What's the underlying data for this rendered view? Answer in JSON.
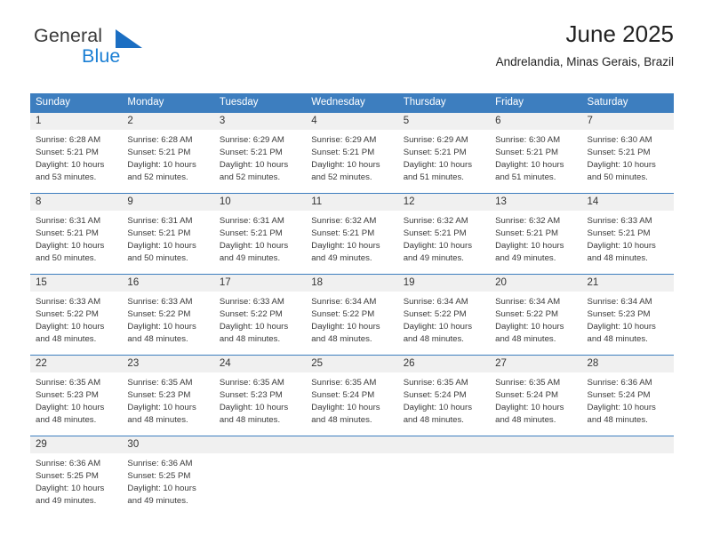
{
  "brand": {
    "name_part1": "General",
    "name_part2": "Blue",
    "mark_icon": "triangle-flag-icon",
    "colors": {
      "text": "#3a3a3a",
      "accent": "#1b7fd4"
    }
  },
  "header": {
    "title": "June 2025",
    "subtitle": "Andrelandia, Minas Gerais, Brazil"
  },
  "theme": {
    "header_bg": "#3d7ebf",
    "header_text": "#ffffff",
    "daynum_bg": "#f0f0f0",
    "grid_line": "#3d7ebf",
    "body_text": "#3a3a3a"
  },
  "calendar": {
    "weekday_headers": [
      "Sunday",
      "Monday",
      "Tuesday",
      "Wednesday",
      "Thursday",
      "Friday",
      "Saturday"
    ],
    "weeks": [
      [
        {
          "day": "1",
          "sunrise": "Sunrise: 6:28 AM",
          "sunset": "Sunset: 5:21 PM",
          "daylight": "Daylight: 10 hours and 53 minutes."
        },
        {
          "day": "2",
          "sunrise": "Sunrise: 6:28 AM",
          "sunset": "Sunset: 5:21 PM",
          "daylight": "Daylight: 10 hours and 52 minutes."
        },
        {
          "day": "3",
          "sunrise": "Sunrise: 6:29 AM",
          "sunset": "Sunset: 5:21 PM",
          "daylight": "Daylight: 10 hours and 52 minutes."
        },
        {
          "day": "4",
          "sunrise": "Sunrise: 6:29 AM",
          "sunset": "Sunset: 5:21 PM",
          "daylight": "Daylight: 10 hours and 52 minutes."
        },
        {
          "day": "5",
          "sunrise": "Sunrise: 6:29 AM",
          "sunset": "Sunset: 5:21 PM",
          "daylight": "Daylight: 10 hours and 51 minutes."
        },
        {
          "day": "6",
          "sunrise": "Sunrise: 6:30 AM",
          "sunset": "Sunset: 5:21 PM",
          "daylight": "Daylight: 10 hours and 51 minutes."
        },
        {
          "day": "7",
          "sunrise": "Sunrise: 6:30 AM",
          "sunset": "Sunset: 5:21 PM",
          "daylight": "Daylight: 10 hours and 50 minutes."
        }
      ],
      [
        {
          "day": "8",
          "sunrise": "Sunrise: 6:31 AM",
          "sunset": "Sunset: 5:21 PM",
          "daylight": "Daylight: 10 hours and 50 minutes."
        },
        {
          "day": "9",
          "sunrise": "Sunrise: 6:31 AM",
          "sunset": "Sunset: 5:21 PM",
          "daylight": "Daylight: 10 hours and 50 minutes."
        },
        {
          "day": "10",
          "sunrise": "Sunrise: 6:31 AM",
          "sunset": "Sunset: 5:21 PM",
          "daylight": "Daylight: 10 hours and 49 minutes."
        },
        {
          "day": "11",
          "sunrise": "Sunrise: 6:32 AM",
          "sunset": "Sunset: 5:21 PM",
          "daylight": "Daylight: 10 hours and 49 minutes."
        },
        {
          "day": "12",
          "sunrise": "Sunrise: 6:32 AM",
          "sunset": "Sunset: 5:21 PM",
          "daylight": "Daylight: 10 hours and 49 minutes."
        },
        {
          "day": "13",
          "sunrise": "Sunrise: 6:32 AM",
          "sunset": "Sunset: 5:21 PM",
          "daylight": "Daylight: 10 hours and 49 minutes."
        },
        {
          "day": "14",
          "sunrise": "Sunrise: 6:33 AM",
          "sunset": "Sunset: 5:21 PM",
          "daylight": "Daylight: 10 hours and 48 minutes."
        }
      ],
      [
        {
          "day": "15",
          "sunrise": "Sunrise: 6:33 AM",
          "sunset": "Sunset: 5:22 PM",
          "daylight": "Daylight: 10 hours and 48 minutes."
        },
        {
          "day": "16",
          "sunrise": "Sunrise: 6:33 AM",
          "sunset": "Sunset: 5:22 PM",
          "daylight": "Daylight: 10 hours and 48 minutes."
        },
        {
          "day": "17",
          "sunrise": "Sunrise: 6:33 AM",
          "sunset": "Sunset: 5:22 PM",
          "daylight": "Daylight: 10 hours and 48 minutes."
        },
        {
          "day": "18",
          "sunrise": "Sunrise: 6:34 AM",
          "sunset": "Sunset: 5:22 PM",
          "daylight": "Daylight: 10 hours and 48 minutes."
        },
        {
          "day": "19",
          "sunrise": "Sunrise: 6:34 AM",
          "sunset": "Sunset: 5:22 PM",
          "daylight": "Daylight: 10 hours and 48 minutes."
        },
        {
          "day": "20",
          "sunrise": "Sunrise: 6:34 AM",
          "sunset": "Sunset: 5:22 PM",
          "daylight": "Daylight: 10 hours and 48 minutes."
        },
        {
          "day": "21",
          "sunrise": "Sunrise: 6:34 AM",
          "sunset": "Sunset: 5:23 PM",
          "daylight": "Daylight: 10 hours and 48 minutes."
        }
      ],
      [
        {
          "day": "22",
          "sunrise": "Sunrise: 6:35 AM",
          "sunset": "Sunset: 5:23 PM",
          "daylight": "Daylight: 10 hours and 48 minutes."
        },
        {
          "day": "23",
          "sunrise": "Sunrise: 6:35 AM",
          "sunset": "Sunset: 5:23 PM",
          "daylight": "Daylight: 10 hours and 48 minutes."
        },
        {
          "day": "24",
          "sunrise": "Sunrise: 6:35 AM",
          "sunset": "Sunset: 5:23 PM",
          "daylight": "Daylight: 10 hours and 48 minutes."
        },
        {
          "day": "25",
          "sunrise": "Sunrise: 6:35 AM",
          "sunset": "Sunset: 5:24 PM",
          "daylight": "Daylight: 10 hours and 48 minutes."
        },
        {
          "day": "26",
          "sunrise": "Sunrise: 6:35 AM",
          "sunset": "Sunset: 5:24 PM",
          "daylight": "Daylight: 10 hours and 48 minutes."
        },
        {
          "day": "27",
          "sunrise": "Sunrise: 6:35 AM",
          "sunset": "Sunset: 5:24 PM",
          "daylight": "Daylight: 10 hours and 48 minutes."
        },
        {
          "day": "28",
          "sunrise": "Sunrise: 6:36 AM",
          "sunset": "Sunset: 5:24 PM",
          "daylight": "Daylight: 10 hours and 48 minutes."
        }
      ],
      [
        {
          "day": "29",
          "sunrise": "Sunrise: 6:36 AM",
          "sunset": "Sunset: 5:25 PM",
          "daylight": "Daylight: 10 hours and 49 minutes."
        },
        {
          "day": "30",
          "sunrise": "Sunrise: 6:36 AM",
          "sunset": "Sunset: 5:25 PM",
          "daylight": "Daylight: 10 hours and 49 minutes."
        },
        {
          "day": "",
          "sunrise": "",
          "sunset": "",
          "daylight": ""
        },
        {
          "day": "",
          "sunrise": "",
          "sunset": "",
          "daylight": ""
        },
        {
          "day": "",
          "sunrise": "",
          "sunset": "",
          "daylight": ""
        },
        {
          "day": "",
          "sunrise": "",
          "sunset": "",
          "daylight": ""
        },
        {
          "day": "",
          "sunrise": "",
          "sunset": "",
          "daylight": ""
        }
      ]
    ]
  }
}
